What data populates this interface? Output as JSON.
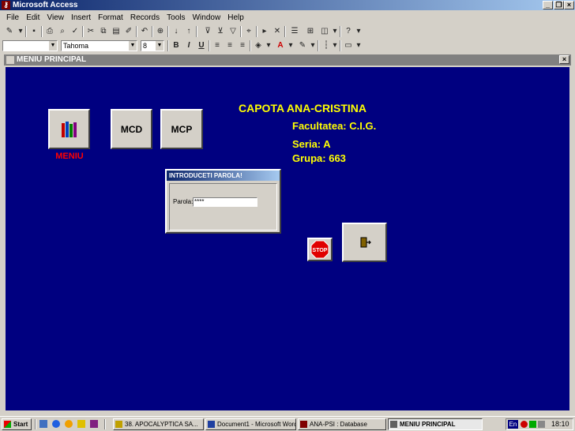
{
  "app": {
    "title": "Microsoft Access"
  },
  "menu": [
    "File",
    "Edit",
    "View",
    "Insert",
    "Format",
    "Records",
    "Tools",
    "Window",
    "Help"
  ],
  "format_toolbar": {
    "font": "Tahoma",
    "size": "8",
    "bold": "B",
    "italic": "I",
    "underline": "U"
  },
  "form": {
    "title": "MENIU PRINCIPAL",
    "menu_label": "MENIU",
    "mcd_label": "MCD",
    "mcp_label": "MCP",
    "author": "CAPOTA ANA-CRISTINA",
    "faculty": "Facultatea: C.I.G.",
    "series": "Seria: A",
    "group": "Grupa: 663",
    "stop_label": "STOP"
  },
  "dialog": {
    "title": "INTRODUCETI PAROLA!",
    "field_label": "Parola:",
    "value": "****"
  },
  "taskbar": {
    "start": "Start",
    "tasks": [
      "38. APOCALYPTICA   SA...",
      "Document1 - Microsoft Word",
      "ANA-PSI : Database",
      "MENIU PRINCIPAL"
    ],
    "lang": "En",
    "time": "18:10"
  },
  "colors": {
    "form_bg": "#000080",
    "accent_yellow": "#ffff00",
    "menu_red": "#ff0000"
  }
}
